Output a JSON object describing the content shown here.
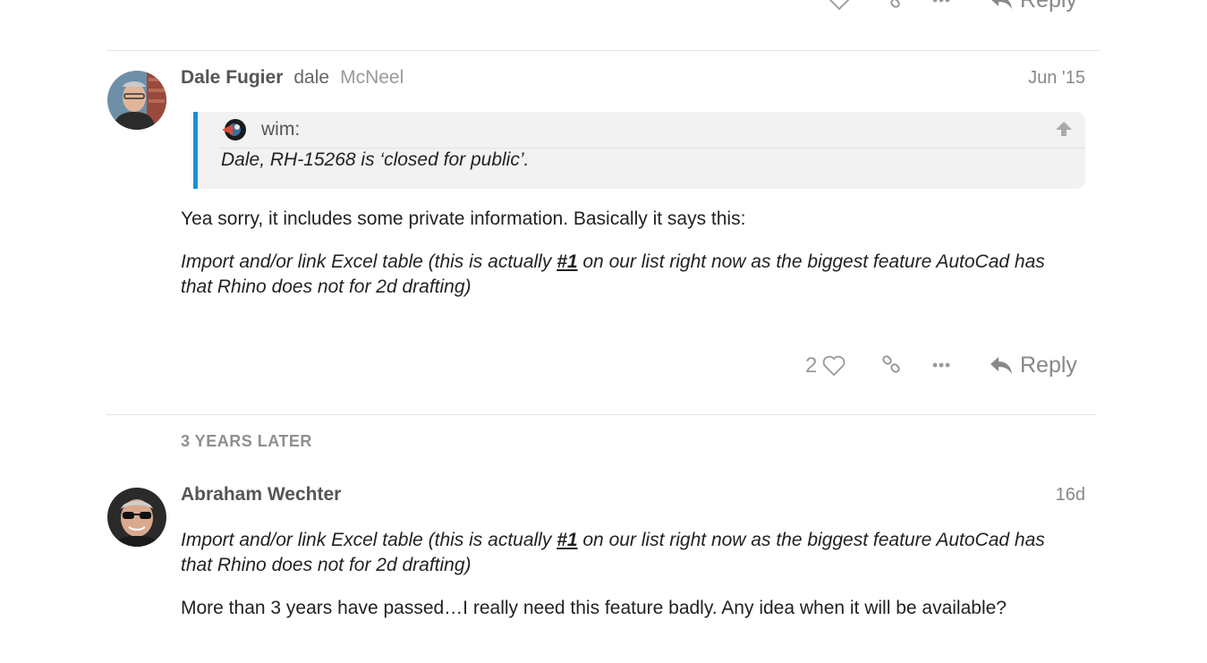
{
  "prev_post": {
    "reply_label": "Reply"
  },
  "posts": [
    {
      "username": "Dale Fugier",
      "handle": "dale",
      "group": "McNeel",
      "date": "Jun '15",
      "quote": {
        "author": "wim:",
        "text": "Dale, RH-15268 is ‘closed for public’."
      },
      "paragraph1": "Yea sorry, it includes some private information. Basically it says this:",
      "paragraph2_before": "Import and/or link Excel table (this is actually ",
      "paragraph2_link": "#1",
      "paragraph2_after": " on our list right now as the biggest feature AutoCad has that Rhino does not for 2d drafting)",
      "like_count": "2",
      "reply_label": "Reply"
    },
    {
      "username": "Abraham Wechter",
      "date": "16d",
      "quote_before": "Import and/or link Excel table (this is actually ",
      "quote_link": "#1",
      "quote_after": " on our list right now as the biggest feature AutoCad has that Rhino does not for 2d drafting)",
      "paragraph": "More than 3 years have passed…I really need this feature badly. Any idea when it will be available?"
    }
  ],
  "time_gap": "3 YEARS LATER",
  "icons": {
    "like": "heart-icon",
    "link": "link-icon",
    "more": "ellipsis-icon",
    "reply": "reply-arrow-icon",
    "quote_expand": "arrow-up-icon"
  },
  "colors": {
    "quote_border": "#1a8fd8",
    "quote_bg": "#f2f2f2",
    "muted": "#999999"
  }
}
